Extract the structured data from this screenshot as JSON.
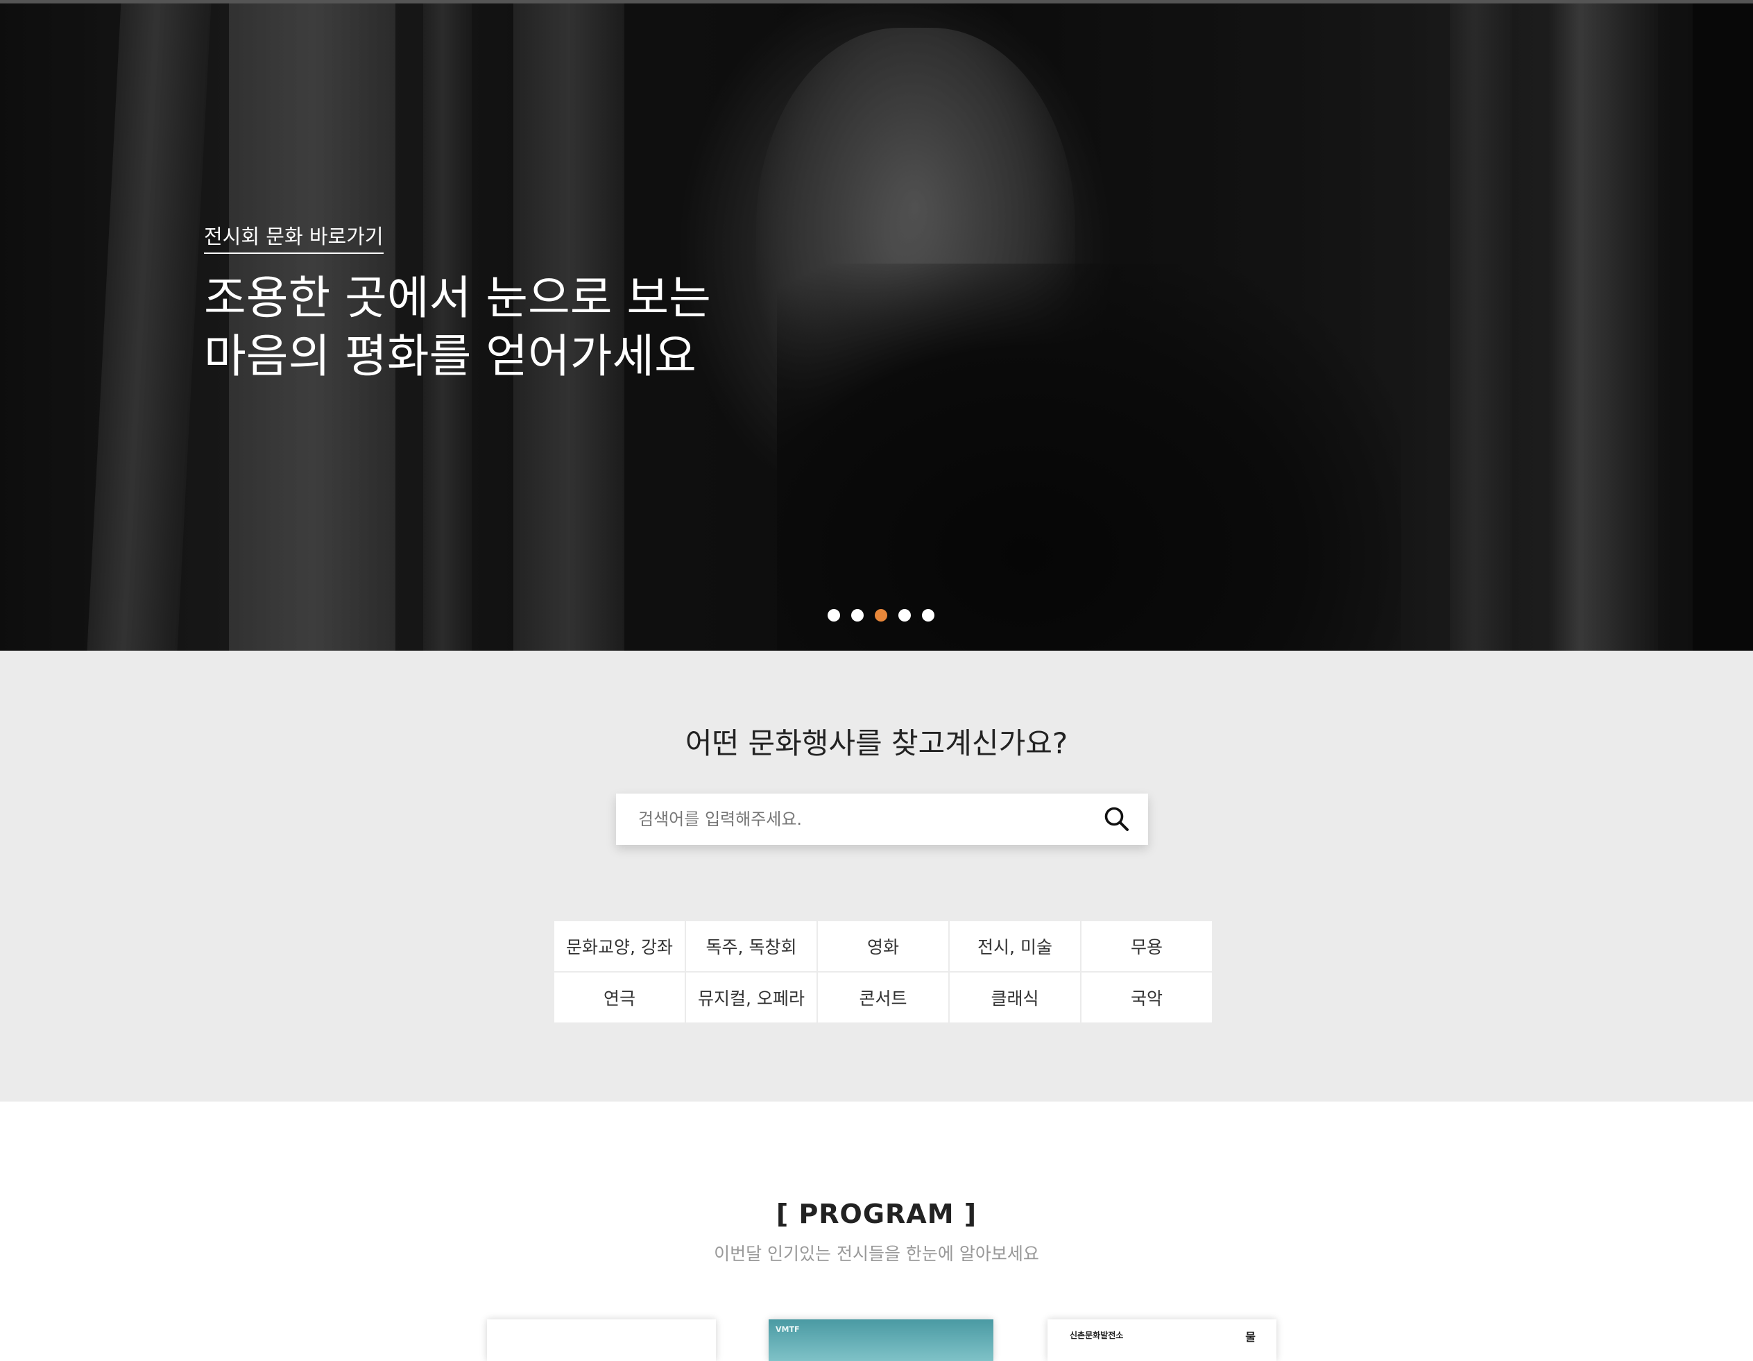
{
  "hero": {
    "link_label": "전시회 문화 바로가기",
    "headline_line1": "조용한 곳에서 눈으로 보는",
    "headline_line2": "마음의 평화를 얻어가세요",
    "slides": {
      "count": 5,
      "active_index": 2
    },
    "colors": {
      "active_dot": "#e8873a",
      "dot": "#ffffff"
    }
  },
  "search": {
    "title": "어떤 문화행사를 찾고계신가요?",
    "placeholder": "검색어를 입력해주세요.",
    "value": "",
    "button_icon": "search-icon"
  },
  "categories": [
    "문화교양, 강좌",
    "독주, 독창회",
    "영화",
    "전시, 미술",
    "무용",
    "연극",
    "뮤지컬, 오페라",
    "콘서트",
    "클래식",
    "국악"
  ],
  "program": {
    "title": "[ PROGRAM ]",
    "subtitle": "이번달 인기있는 전시들을 한눈에 알아보세요",
    "cards": [
      {
        "label": "",
        "side_label": ""
      },
      {
        "label": "VMTF",
        "side_label": ""
      },
      {
        "label": "신촌문화발전소",
        "side_label": "물"
      }
    ]
  }
}
